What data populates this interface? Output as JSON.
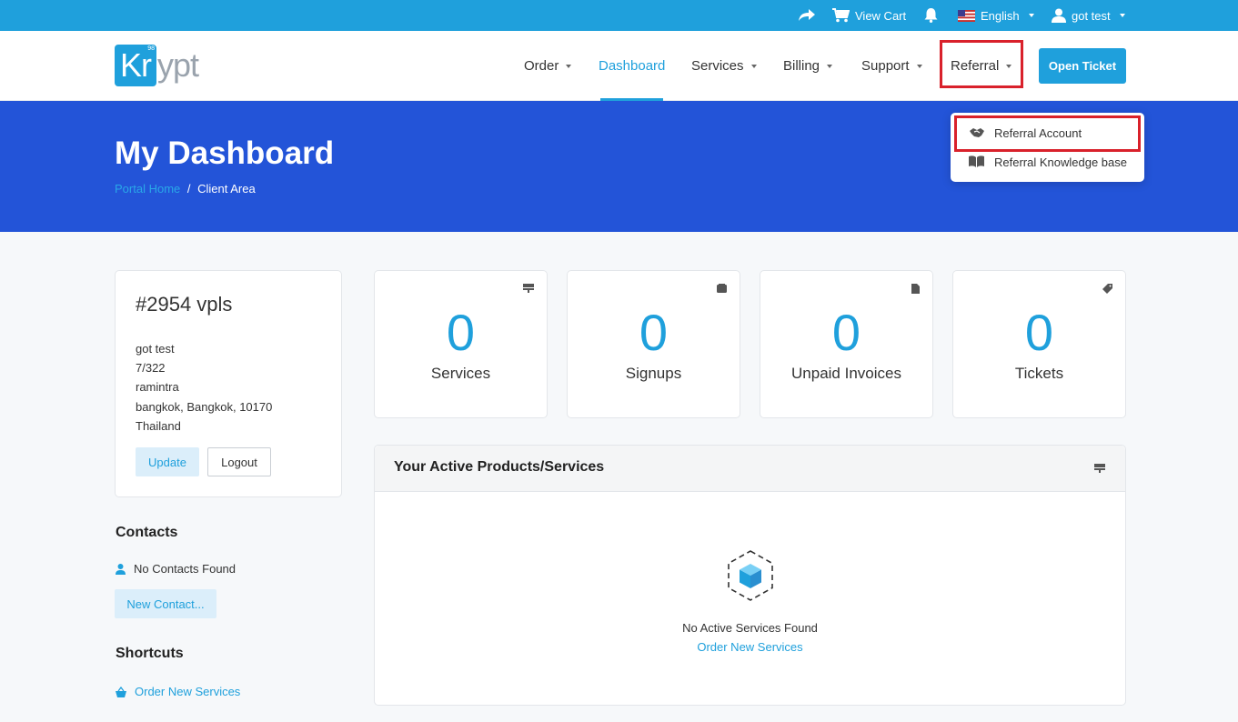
{
  "topbar": {
    "view_cart": "View Cart",
    "language": "English",
    "user": "got test"
  },
  "logo": {
    "mark": "Kr",
    "mark_sup": "98",
    "rest": "ypt"
  },
  "nav": {
    "order": "Order",
    "dashboard": "Dashboard",
    "services": "Services",
    "billing": "Billing",
    "support": "Support",
    "referral": "Referral",
    "open_ticket": "Open Ticket"
  },
  "referral_menu": {
    "items": [
      {
        "label": "Referral Account",
        "icon": "handshake-icon"
      },
      {
        "label": "Referral Knowledge base",
        "icon": "book-icon"
      }
    ]
  },
  "hero": {
    "title": "My Dashboard",
    "breadcrumb_home": "Portal Home",
    "breadcrumb_sep": "/",
    "breadcrumb_current": "Client Area"
  },
  "profile": {
    "name": "#2954 vpls",
    "lines": [
      "got test",
      "7/322",
      "ramintra",
      "bangkok, Bangkok, 10170",
      "Thailand"
    ],
    "update": "Update",
    "logout": "Logout"
  },
  "contacts": {
    "title": "Contacts",
    "empty": "No Contacts Found",
    "new_contact": "New Contact..."
  },
  "shortcuts": {
    "title": "Shortcuts",
    "order_new": "Order New Services"
  },
  "stats": [
    {
      "value": "0",
      "label": "Services",
      "icon": "server-icon"
    },
    {
      "value": "0",
      "label": "Signups",
      "icon": "cart-icon"
    },
    {
      "value": "0",
      "label": "Unpaid Invoices",
      "icon": "file-icon"
    },
    {
      "value": "0",
      "label": "Tickets",
      "icon": "tag-icon"
    }
  ],
  "active_services": {
    "title": "Your Active Products/Services",
    "empty": "No Active Services Found",
    "order_link": "Order New Services"
  },
  "colors": {
    "accent": "#1fa0dc",
    "hero": "#2354d8",
    "highlight": "#d9212b"
  }
}
